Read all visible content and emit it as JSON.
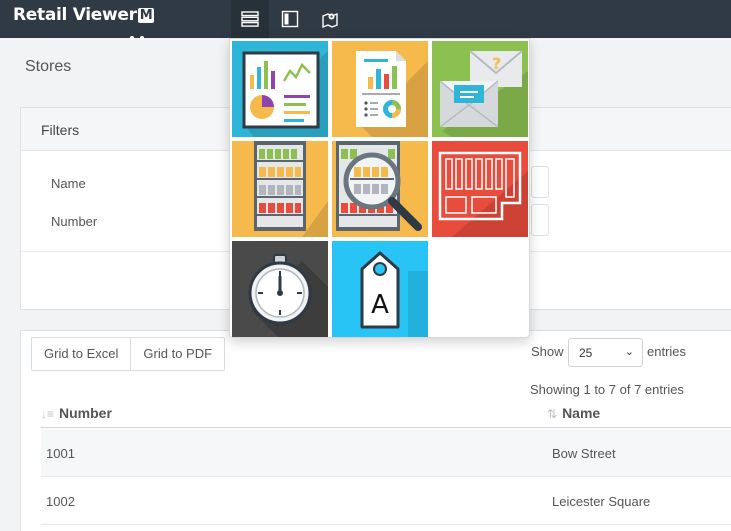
{
  "app": {
    "brand_text": "Retail Viewer",
    "brand_badge": "M"
  },
  "toolbar": {
    "buttons": [
      {
        "icon": "list-view-icon"
      },
      {
        "icon": "sidebar-toggle-icon"
      },
      {
        "icon": "map-store-icon"
      }
    ]
  },
  "page": {
    "title": "Stores"
  },
  "filters": {
    "title": "Filters",
    "fields": [
      {
        "label": "Name",
        "value": ""
      },
      {
        "label": "Number",
        "value": ""
      }
    ]
  },
  "grid": {
    "export_buttons": [
      "Grid to Excel",
      "Grid to PDF"
    ],
    "show_label": "Show",
    "page_size": "25",
    "entries_label": "entries",
    "info": "Showing 1 to 7 of 7 entries",
    "columns": [
      "Number",
      "Name"
    ],
    "rows": [
      {
        "number": "1001",
        "name": "Bow Street"
      },
      {
        "number": "1002",
        "name": "Leicester Square"
      }
    ]
  },
  "app_menu": {
    "tiles": [
      {
        "icon": "dashboard-charts-icon",
        "color": "#2fb5d8"
      },
      {
        "icon": "report-document-icon",
        "color": "#f6b94c"
      },
      {
        "icon": "messages-mail-icon",
        "color": "#8cc152"
      },
      {
        "icon": "store-shelves-icon",
        "color": "#f6b94c"
      },
      {
        "icon": "shelf-inspection-magnifier-icon",
        "color": "#f6b94c"
      },
      {
        "icon": "store-floor-plan-icon",
        "color": "#e74c3c"
      },
      {
        "icon": "stopwatch-icon",
        "color": "#4a4a4a"
      },
      {
        "icon": "price-tag-icon",
        "color": "#29c4f6"
      }
    ]
  }
}
